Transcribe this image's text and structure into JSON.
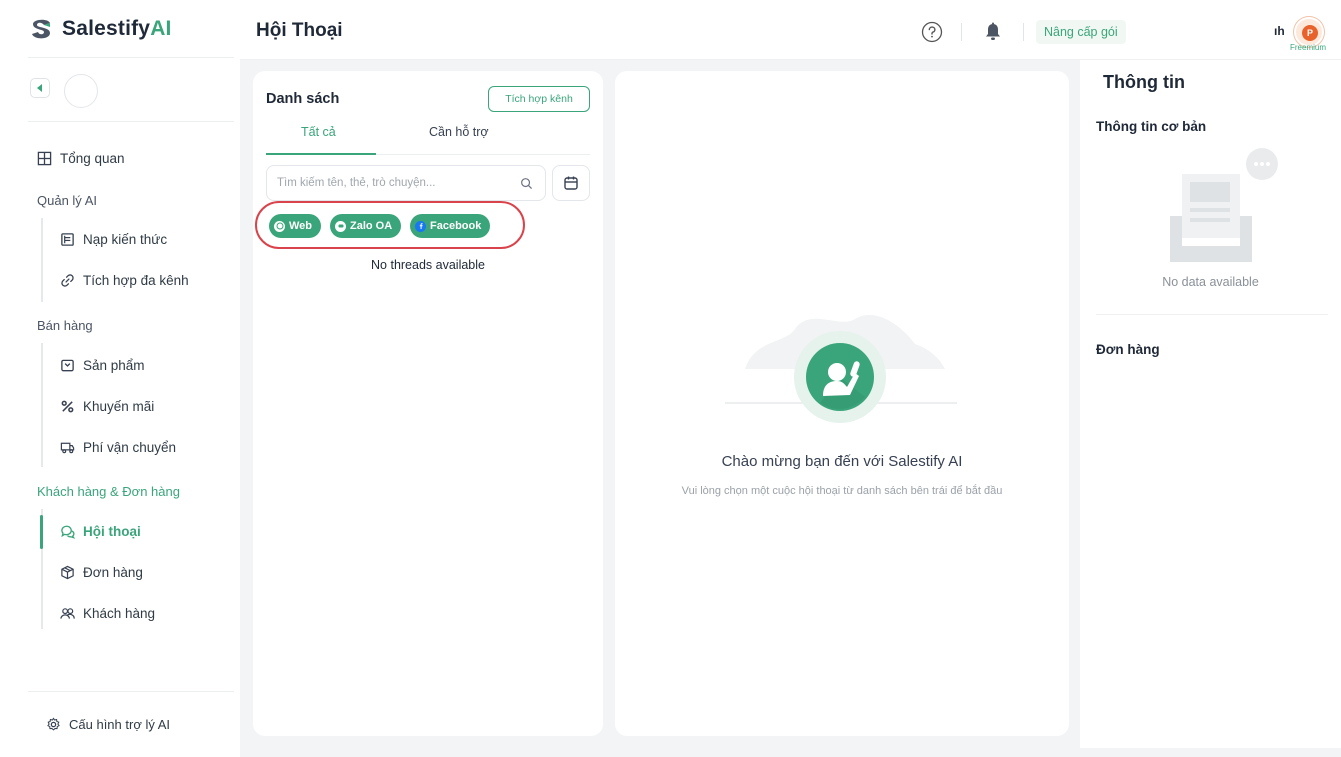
{
  "brand": {
    "name": "Salestify",
    "suffix": "AI"
  },
  "sidebar": {
    "overview": "Tổng quan",
    "sections": {
      "ai_management": "Quản lý AI",
      "sales": "Bán hàng",
      "customers_orders": "Khách hàng & Đơn hàng"
    },
    "items": {
      "knowledge": "Nạp kiến thức",
      "omnichannel": "Tích hợp đa kênh",
      "products": "Sản phẩm",
      "promotions": "Khuyến mãi",
      "shipping": "Phí vận chuyển",
      "conversations": "Hội thoại",
      "orders": "Đơn hàng",
      "customers": "Khách hàng"
    },
    "active_item": "conversations",
    "footer": "Cấu hình trợ lý AI"
  },
  "header": {
    "title": "Hội Thoại",
    "upgrade_label": "Nâng cấp gói",
    "user_name_fragment": "ıh",
    "avatar_initial": "P",
    "plan_label": "Freemium"
  },
  "list": {
    "title": "Danh sách",
    "integrate_label": "Tích hợp kênh",
    "tabs": [
      "Tất cả",
      "Cần hỗ trợ"
    ],
    "active_tab": 0,
    "search_placeholder": "Tìm kiếm tên, thẻ, trò chuyện...",
    "channels": [
      "Web",
      "Zalo OA",
      "Facebook"
    ],
    "empty_text": "No threads available"
  },
  "chat": {
    "welcome_title": "Chào mừng bạn đến với Salestify AI",
    "welcome_sub": "Vui lòng chọn một cuộc hội thoại từ danh sách bên trái để bắt đầu"
  },
  "info": {
    "title": "Thông tin",
    "basic_title": "Thông tin cơ bản",
    "no_data": "No data available",
    "orders_title": "Đơn hàng"
  },
  "colors": {
    "accent": "#3aa57a",
    "highlight_ring": "#d9434b",
    "upgrade_bg": "#f1f8f4"
  },
  "icons": {
    "brand": "salestify-logo-icon",
    "collapse": "chevron-left-icon",
    "overview": "grid-icon",
    "knowledge": "document-icon",
    "omnichannel": "link-icon",
    "products": "box-outline-icon",
    "promotions": "percent-icon",
    "shipping": "truck-icon",
    "conversations": "chat-bubbles-icon",
    "orders": "package-icon",
    "customers": "users-icon",
    "settings": "gear-icon",
    "help": "question-circle-icon",
    "bell": "bell-icon",
    "search": "search-icon",
    "calendar": "calendar-icon"
  }
}
